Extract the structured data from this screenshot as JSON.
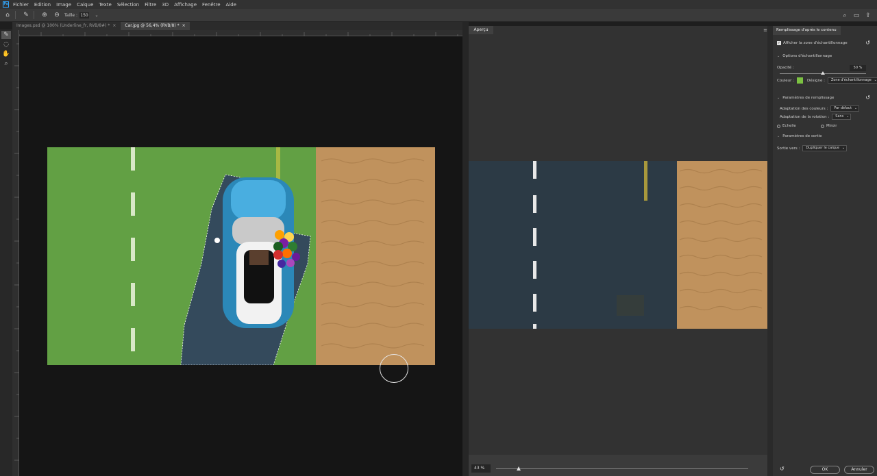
{
  "app": {
    "logo_text": "Ps"
  },
  "menu": [
    "Fichier",
    "Edition",
    "Image",
    "Calque",
    "Texte",
    "Sélection",
    "Filtre",
    "3D",
    "Affichage",
    "Fenêtre",
    "Aide"
  ],
  "options": {
    "size_label": "Taille :",
    "size_value": "150"
  },
  "tabs": [
    {
      "label": "Images.psd @ 100% (Underline_fr, RVB/8#) *",
      "active": false
    },
    {
      "label": "Car.jpg @ 56,4% (RVB/8) *",
      "active": true
    }
  ],
  "preview": {
    "tab_label": "Aperçu",
    "zoom": "43 %",
    "zoom_level": 0.09
  },
  "settings": {
    "title": "Remplissage d'après le contenu",
    "show_sampling_label": "Afficher la zone d'échantillonnage",
    "sampling_options_label": "Options d'échantillonnage",
    "opacity_label": "Opacité :",
    "opacity_value": "50 %",
    "opacity_level": 0.5,
    "color_label": "Couleur :",
    "color_hex": "#7cc242",
    "designates_label": "Désigne :",
    "designates_value": "Zone d'échantillonnage",
    "fill_params_label": "Paramètres de remplissage",
    "color_adapt_label": "Adaptation des couleurs :",
    "color_adapt_value": "Par défaut",
    "rotation_adapt_label": "Adaptation de la rotation :",
    "rotation_adapt_value": "Sans",
    "scale_label": "Echelle",
    "mirror_label": "Miroir",
    "output_params_label": "Paramètres de sortie",
    "output_to_label": "Sortie vers :",
    "output_to_value": "Dupliquer le calque",
    "ok_label": "OK",
    "cancel_label": "Annuler"
  }
}
